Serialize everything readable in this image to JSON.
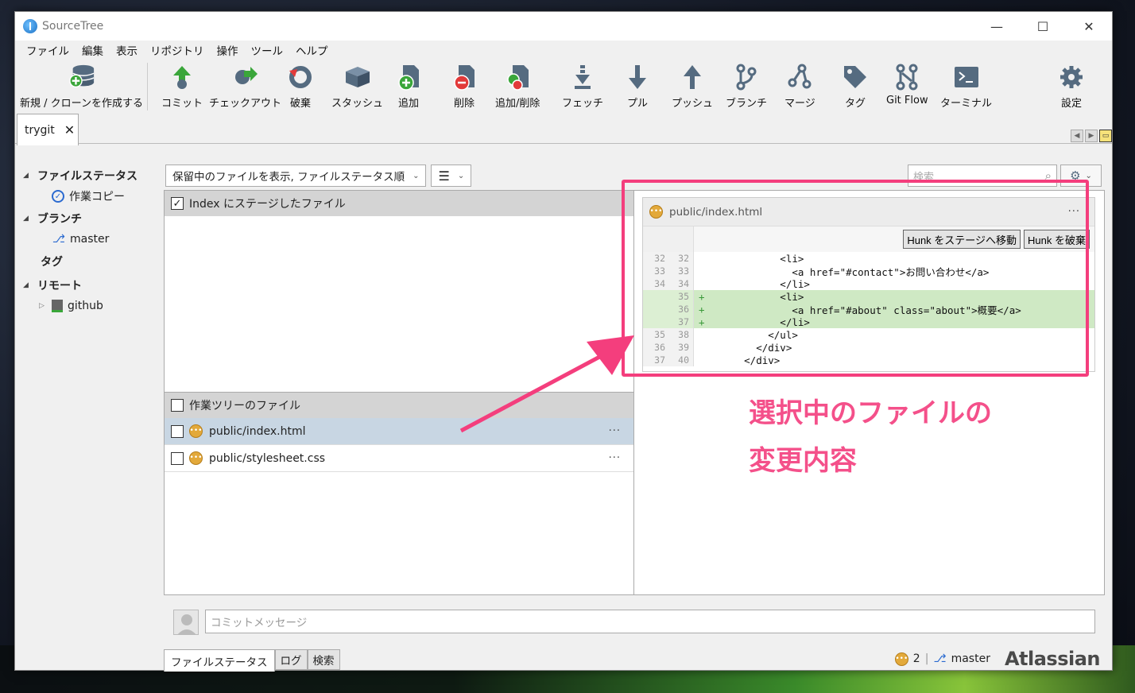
{
  "window": {
    "title": "SourceTree",
    "minimize": "—",
    "maximize": "☐",
    "close": "✕"
  },
  "menu": [
    "ファイル",
    "編集",
    "表示",
    "リポジトリ",
    "操作",
    "ツール",
    "ヘルプ"
  ],
  "toolbar": {
    "new_clone": "新規 / クローンを作成する",
    "commit": "コミット",
    "checkout": "チェックアウト",
    "discard": "破棄",
    "stash": "スタッシュ",
    "add": "追加",
    "remove": "削除",
    "add_remove": "追加/削除",
    "fetch": "フェッチ",
    "pull": "プル",
    "push": "プッシュ",
    "branch": "ブランチ",
    "merge": "マージ",
    "tag": "タグ",
    "gitflow": "Git Flow",
    "terminal": "ターミナル",
    "settings": "設定"
  },
  "repo_tab": {
    "name": "trygit",
    "close": "✕"
  },
  "sidebar": {
    "file_status": "ファイルステータス",
    "working_copy": "作業コピー",
    "branches": "ブランチ",
    "master": "master",
    "tags": "タグ",
    "remotes": "リモート",
    "github": "github"
  },
  "filter": {
    "view_mode": "保留中のファイルを表示, ファイルステータス順",
    "search_placeholder": "検索"
  },
  "staged": {
    "header": "Index にステージしたファイル",
    "checked": "✓"
  },
  "unstaged": {
    "header": "作業ツリーのファイル",
    "files": [
      {
        "name": "public/index.html",
        "more": "···"
      },
      {
        "name": "public/stylesheet.css",
        "more": "···"
      }
    ]
  },
  "diff": {
    "filename": "public/index.html",
    "more": "···",
    "stage_hunk": "Hunk をステージへ移動",
    "discard_hunk": "Hunk を破棄",
    "lines": [
      {
        "old": "32",
        "new": "32",
        "mark": "",
        "text": "            <li>",
        "added": false
      },
      {
        "old": "33",
        "new": "33",
        "mark": "",
        "text": "              <a href=\"#contact\">お問い合わせ</a>",
        "added": false
      },
      {
        "old": "34",
        "new": "34",
        "mark": "",
        "text": "            </li>",
        "added": false
      },
      {
        "old": "",
        "new": "35",
        "mark": "+",
        "text": "            <li>",
        "added": true
      },
      {
        "old": "",
        "new": "36",
        "mark": "+",
        "text": "              <a href=\"#about\" class=\"about\">概要</a>",
        "added": true
      },
      {
        "old": "",
        "new": "37",
        "mark": "+",
        "text": "            </li>",
        "added": true
      },
      {
        "old": "35",
        "new": "38",
        "mark": "",
        "text": "          </ul>",
        "added": false
      },
      {
        "old": "36",
        "new": "39",
        "mark": "",
        "text": "        </div>",
        "added": false
      },
      {
        "old": "37",
        "new": "40",
        "mark": "",
        "text": "      </div>",
        "added": false
      }
    ]
  },
  "annotation": {
    "line1": "選択中のファイルの",
    "line2": "変更内容"
  },
  "commit": {
    "placeholder": "コミットメッセージ"
  },
  "bottom_tabs": [
    "ファイルステータス",
    "ログ",
    "検索"
  ],
  "status": {
    "pending_count": "2",
    "separator": "|",
    "branch": "master",
    "brand": "Atlassian"
  },
  "colors": {
    "highlight": "#f43e7d",
    "added_line": "#cfe9c4",
    "selected_row": "#c8d6e3"
  }
}
